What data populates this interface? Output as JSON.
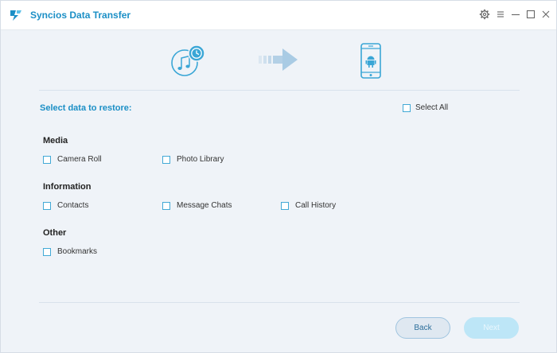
{
  "app": {
    "title": "Syncios Data Transfer"
  },
  "window_controls": [
    "gear-icon",
    "menu-icon",
    "minimize-icon",
    "maximize-icon",
    "close-icon"
  ],
  "flow": {
    "source_icon": "itunes-backup-icon",
    "arrow_icon": "arrow-right-icon",
    "target_icon": "android-phone-icon"
  },
  "restore": {
    "heading": "Select data to restore:",
    "select_all": "Select All",
    "categories": [
      {
        "name": "Media",
        "options": [
          "Camera Roll",
          "Photo Library"
        ]
      },
      {
        "name": "Information",
        "options": [
          "Contacts",
          "Message Chats",
          "Call History"
        ]
      },
      {
        "name": "Other",
        "options": [
          "Bookmarks"
        ]
      }
    ]
  },
  "buttons": {
    "back": "Back",
    "next": "Next"
  },
  "colors": {
    "accent": "#1b8fc6",
    "checkbox_border": "#42a9d6",
    "next_disabled": "#bde6f7"
  }
}
